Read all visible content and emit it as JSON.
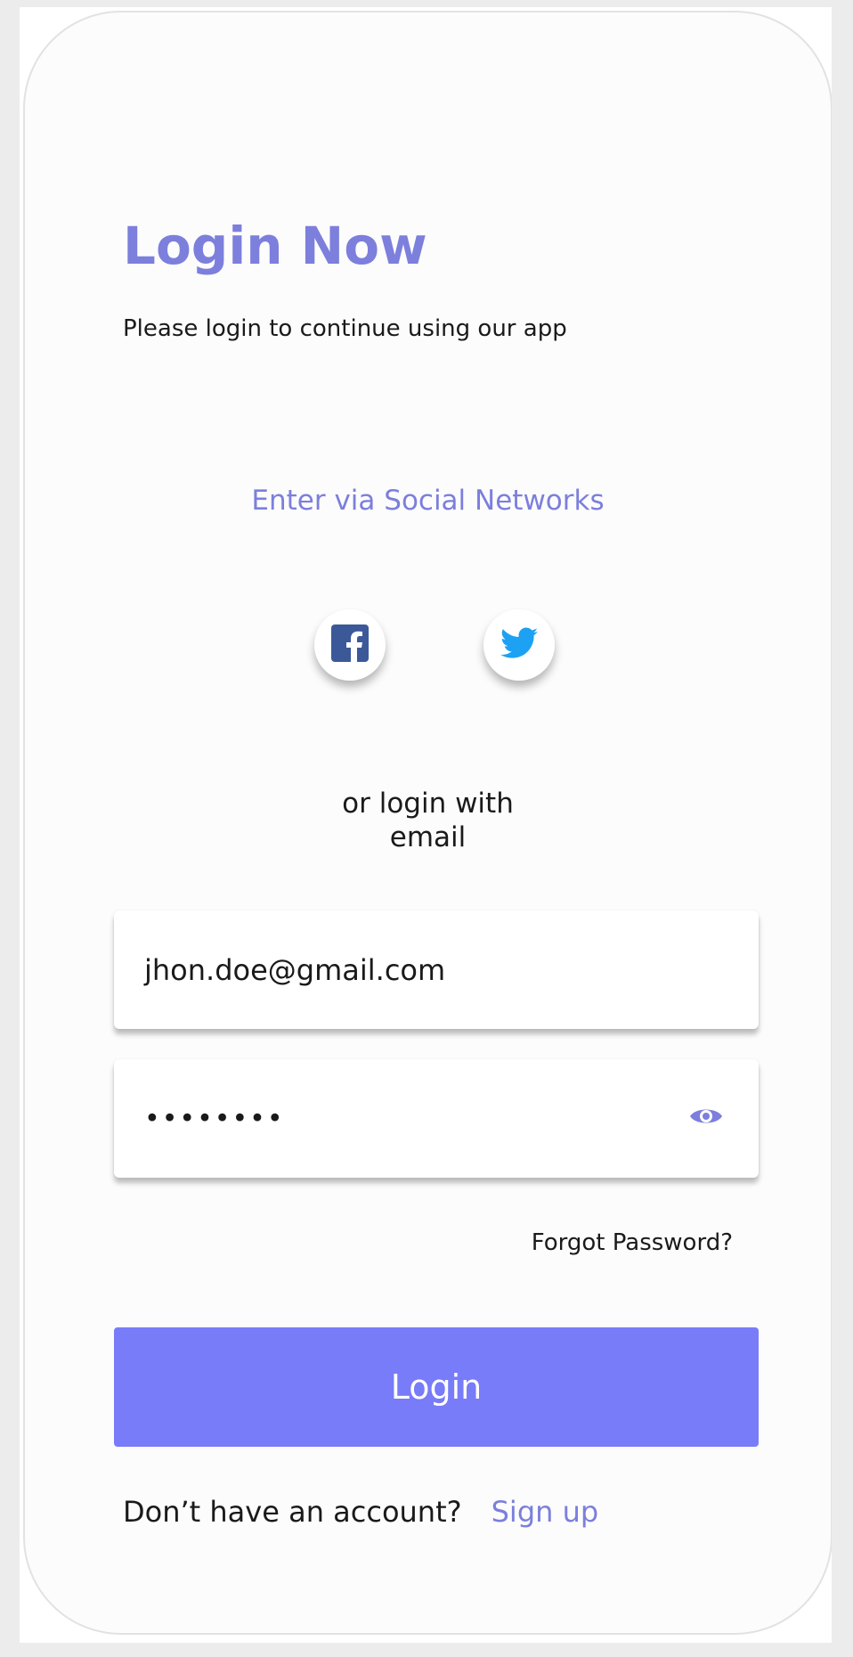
{
  "header": {
    "title": "Login Now",
    "subtitle": "Please login to continue using our app"
  },
  "social": {
    "heading": "Enter via Social Networks",
    "buttons": [
      {
        "icon": "facebook-icon",
        "color": "#3b5998"
      },
      {
        "icon": "twitter-icon",
        "color": "#1da1f2"
      }
    ]
  },
  "divider": {
    "line1": "or login with",
    "line2": "email"
  },
  "form": {
    "email_value": "jhon.doe@gmail.com",
    "password_value": "••••••••",
    "forgot_label": "Forgot Password?",
    "login_label": "Login"
  },
  "footer": {
    "prompt": "Don’t have an account?",
    "signup_label": "Sign up"
  },
  "colors": {
    "accent": "#7c7fdc",
    "button": "#787cf8",
    "text": "#1a1a1a"
  }
}
